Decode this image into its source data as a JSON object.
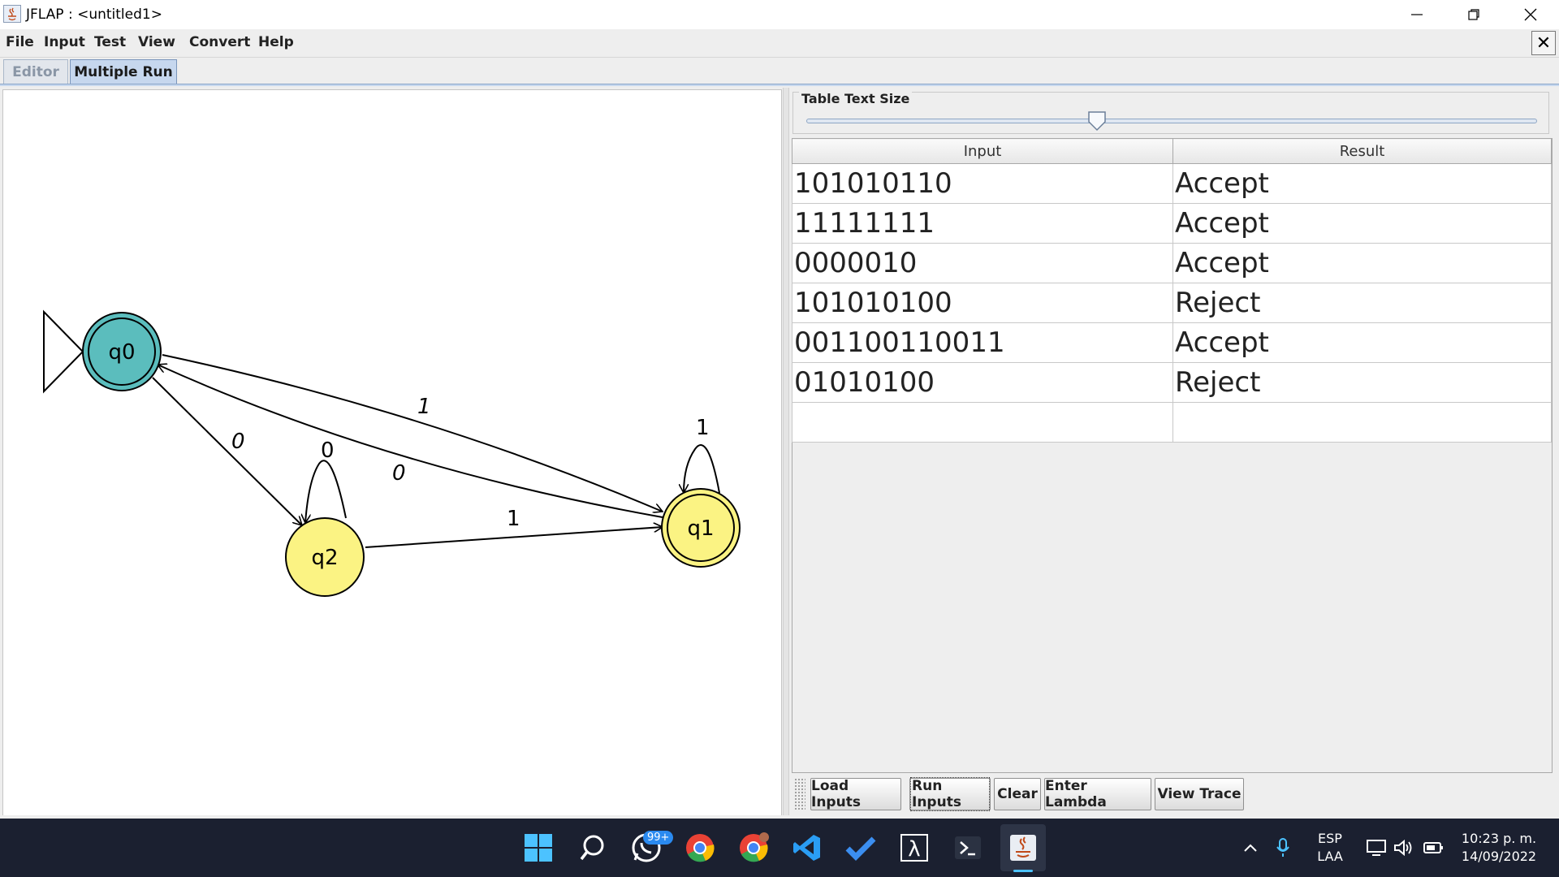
{
  "window": {
    "title": "JFLAP : <untitled1>"
  },
  "menu": [
    "File",
    "Input",
    "Test",
    "View",
    "Convert",
    "Help"
  ],
  "tabs": [
    {
      "label": "Editor",
      "active": false
    },
    {
      "label": "Multiple Run",
      "active": true
    }
  ],
  "automaton": {
    "initial_state": "q0",
    "states": [
      {
        "id": "q0",
        "label": "q0",
        "final": true,
        "highlighted": true
      },
      {
        "id": "q1",
        "label": "q1",
        "final": true,
        "highlighted": false
      },
      {
        "id": "q2",
        "label": "q2",
        "final": false,
        "highlighted": false
      }
    ],
    "transitions": [
      {
        "from": "q0",
        "to": "q1",
        "symbol": "1"
      },
      {
        "from": "q1",
        "to": "q0",
        "symbol": "0"
      },
      {
        "from": "q0",
        "to": "q2",
        "symbol": "0"
      },
      {
        "from": "q2",
        "to": "q2",
        "symbol": "0"
      },
      {
        "from": "q2",
        "to": "q1",
        "symbol": "1"
      },
      {
        "from": "q1",
        "to": "q1",
        "symbol": "1"
      }
    ],
    "colors": {
      "highlight": "#5bbdbd",
      "state": "#fbf383",
      "stroke": "#000000"
    }
  },
  "slider": {
    "label": "Table Text Size",
    "level": 0.4
  },
  "table": {
    "headers": [
      "Input",
      "Result"
    ],
    "rows": [
      {
        "input": "101010110",
        "result": "Accept"
      },
      {
        "input": "11111111",
        "result": "Accept"
      },
      {
        "input": "0000010",
        "result": "Accept"
      },
      {
        "input": "101010100",
        "result": "Reject"
      },
      {
        "input": "001100110011",
        "result": "Accept"
      },
      {
        "input": "01010100",
        "result": "Reject"
      },
      {
        "input": "",
        "result": ""
      }
    ]
  },
  "buttons": {
    "load": "Load Inputs",
    "run": "Run Inputs",
    "clear": "Clear",
    "lambda": "Enter Lambda",
    "trace": "View Trace"
  },
  "taskbar": {
    "whatsapp_badge": "99+",
    "lang_top": "ESP",
    "lang_bottom": "LAA",
    "time": "10:23 p. m.",
    "date": "14/09/2022",
    "icons": [
      "windows-start-icon",
      "search-icon",
      "whatsapp-icon",
      "chrome-icon",
      "chrome-profile-icon",
      "vscode-icon",
      "todo-check-icon",
      "lambda-app-icon",
      "powershell-icon",
      "java-icon"
    ]
  }
}
